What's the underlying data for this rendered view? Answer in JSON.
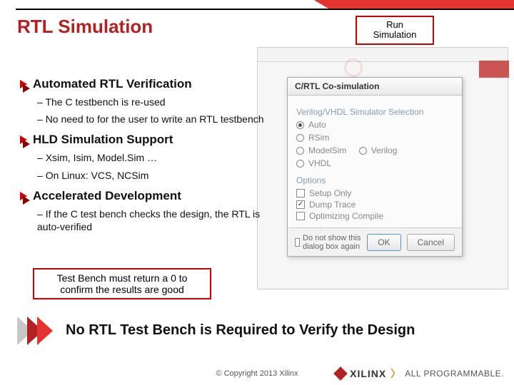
{
  "title": "RTL Simulation",
  "callout": {
    "line1": "Run",
    "line2": "Simulation"
  },
  "sections": [
    {
      "title": "Automated RTL Verification",
      "items": [
        "The C testbench is re-used",
        "No need to for the user to write an RTL testbench"
      ]
    },
    {
      "title": "HLD Simulation Support",
      "items": [
        "Xsim, Isim, Model.Sim …",
        "On Linux: VCS, NCSim"
      ]
    },
    {
      "title": "Accelerated Development",
      "items": [
        "If the C test bench checks the design, the RTL is auto-verified"
      ]
    }
  ],
  "note": "Test Bench must return a 0 to confirm the results are good",
  "headline": "No RTL Test Bench is Required to Verify the Design",
  "dialog": {
    "title": "C/RTL Co-simulation",
    "group1": "Verilog/VHDL Simulator Selection",
    "radios": {
      "auto": "Auto",
      "rsim": "RSim",
      "modelsim": "ModelSim",
      "verilog": "Verilog",
      "vhdl": "VHDL"
    },
    "group2": "Options",
    "opt_setup": "Setup Only",
    "opt_dump": "Dump Trace",
    "opt_opt": "Optimizing Compile",
    "group3": "Input Arguments",
    "dont": "Do not show this dialog box again",
    "ok": "OK",
    "cancel": "Cancel"
  },
  "footer": {
    "copyright": "© Copyright 2013 Xilinx"
  },
  "brand": {
    "name": "XILINX",
    "tag": "ALL PROGRAMMABLE."
  }
}
